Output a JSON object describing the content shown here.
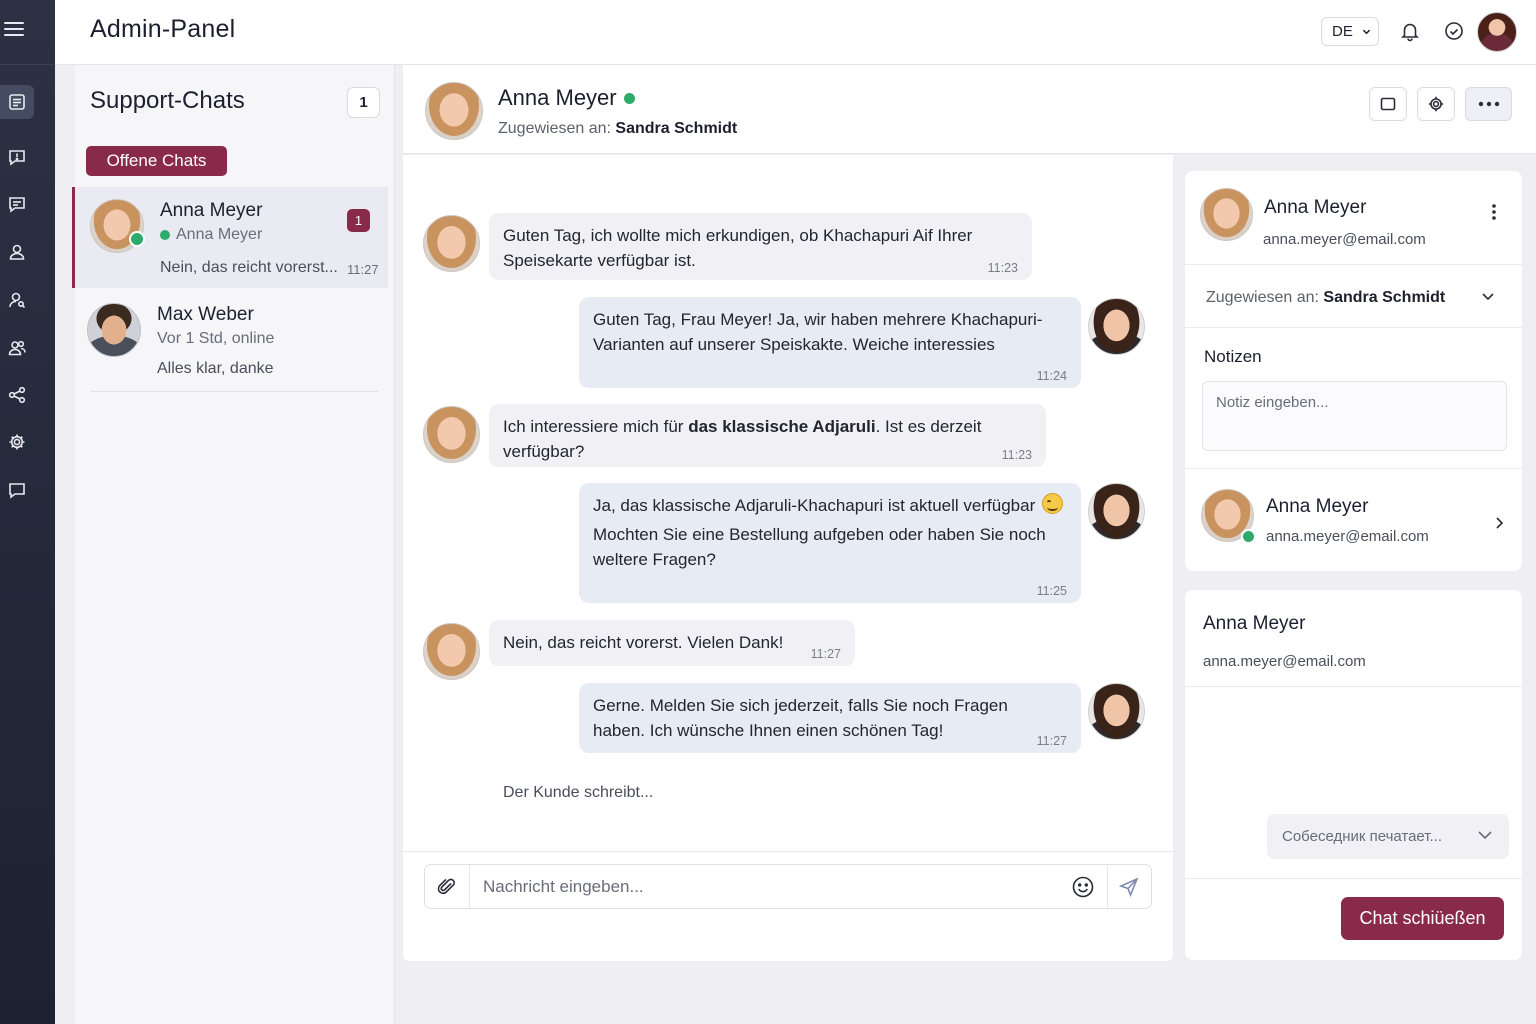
{
  "app": {
    "title": "Admin-Panel",
    "language": "DE"
  },
  "icons": {
    "menu": "hamburger-icon",
    "rail": [
      "inbox-icon",
      "message-alert-icon",
      "chat-icon",
      "user-icon",
      "user-search-icon",
      "users-icon",
      "share-icon",
      "settings-icon",
      "comment-icon"
    ],
    "top": [
      "bell-icon",
      "smile-check-icon"
    ],
    "composer": [
      "paperclip-icon",
      "emoji-icon",
      "send-icon"
    ]
  },
  "colors": {
    "accent": "#8a2a4a",
    "online": "#2eab6b",
    "rail": "#252b3b"
  },
  "chat_list": {
    "title": "Support-Chats",
    "count": "1",
    "filter": "Offene Chats",
    "items": [
      {
        "name": "Anna Meyer",
        "sub": "Anna Meyer",
        "preview": "Nein, das reicht vorerst...",
        "time": "11:27",
        "badge": "1"
      },
      {
        "name": "Max Weber",
        "sub": "Vor 1 Std, online",
        "preview": "Alles klar, danke"
      }
    ]
  },
  "conversation": {
    "name": "Anna Meyer",
    "assigned_label": "Zugewiesen an:",
    "assigned_to": "Sandra Schmidt",
    "messages": [
      {
        "text": "Guten Tag, ich wollte mich erkundigen, ob Khachapuri Aif Ihrer Speisekarte verfügbar ist.",
        "time": "11:23"
      },
      {
        "text": "Guten Tag, Frau Meyer! Ja, wir haben mehrere Khachapuri-Varianten auf unserer Speiskakte. Weiche interessies",
        "time": "11:24"
      },
      {
        "text_a": "Ich interessiere mich für ",
        "text_b": "das klassische Adjaruli",
        "text_c": ". Ist es derzeit verfügbar?",
        "time": "11:23"
      },
      {
        "line1": "Ja, das klassische Adjaruli-Khachapuri ist aktuell verfügbar",
        "line2": "Mochten Sie eine Bestellung aufgeben oder haben Sie noch weltere Fragen?",
        "time": "11:25"
      },
      {
        "text": "Nein, das reicht vorerst. Vielen Dank!",
        "time": "11:27"
      },
      {
        "text": "Gerne. Melden Sie sich jederzeit, falls Sie noch Fragen haben. Ich wünsche Ihnen einen schönen Tag!",
        "time": "11:27"
      }
    ],
    "typing": "Der Kunde schreibt...",
    "input_placeholder": "Nachricht eingeben..."
  },
  "side_panel": {
    "contact": {
      "name": "Anna Meyer",
      "email": "anna.meyer@email.com"
    },
    "assigned_label": "Zugewiesen an:",
    "assigned_to": "Sandra Schmidt",
    "notes_title": "Notizen",
    "notes_placeholder": "Notiz eingeben...",
    "linked": {
      "name": "Anna Meyer",
      "email": "anna.meyer@email.com"
    },
    "summary": {
      "name": "Anna Meyer",
      "email": "anna.meyer@email.com"
    },
    "typing_select": "Собеседник печатает...",
    "close_button": "Chat schiüeßen"
  }
}
